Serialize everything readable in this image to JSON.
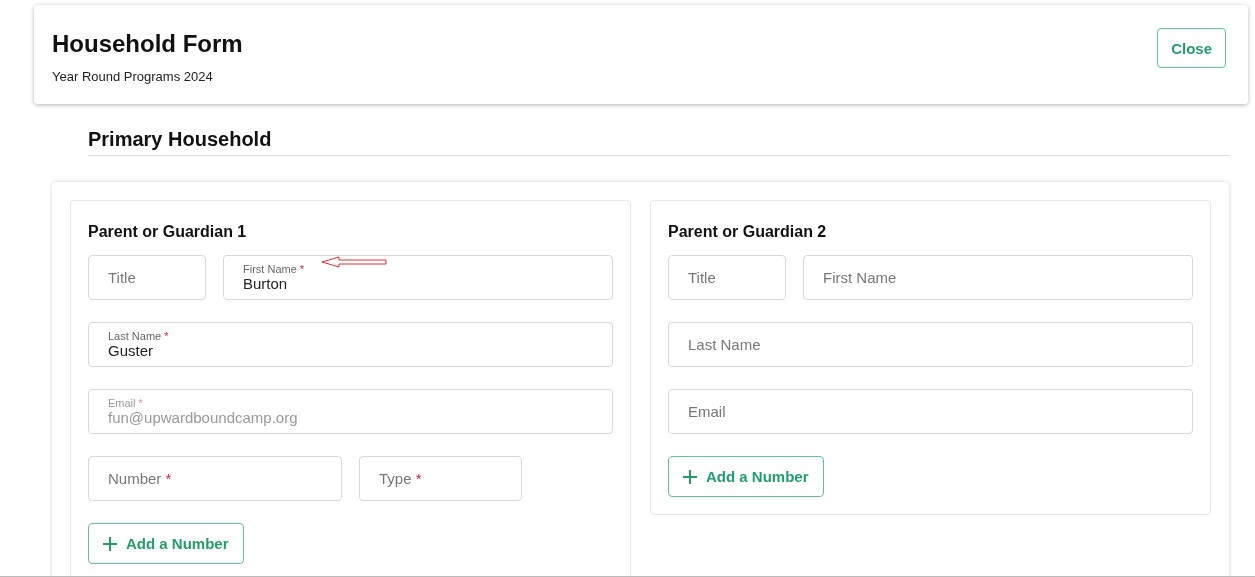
{
  "header": {
    "title": "Household Form",
    "subtitle": "Year Round Programs 2024",
    "close_button": "Close"
  },
  "section": {
    "title": "Primary Household"
  },
  "panels": [
    {
      "title": "Parent or Guardian 1",
      "rows": [
        [
          {
            "kind": "title",
            "placeholder": "Title",
            "disabled": false,
            "annotated": false
          },
          {
            "kind": "wide",
            "label": "First Name",
            "required_mark": "*",
            "value": "Burton",
            "disabled": false,
            "annotated": true
          }
        ],
        [
          {
            "kind": "wide",
            "label": "Last Name",
            "required_mark": "*",
            "value": "Guster",
            "disabled": false,
            "annotated": false
          }
        ],
        [
          {
            "kind": "wide",
            "label": "Email",
            "required_mark": "*",
            "value": "fun@upwardboundcamp.org",
            "disabled": true,
            "annotated": false
          }
        ],
        [
          {
            "kind": "number",
            "placeholder": "Number",
            "required_mark": "*",
            "disabled": false,
            "annotated": false
          },
          {
            "kind": "type",
            "placeholder": "Type",
            "required_mark": "*",
            "disabled": false,
            "annotated": false
          }
        ]
      ],
      "add_button": "Add a Number"
    },
    {
      "title": "Parent or Guardian 2",
      "rows": [
        [
          {
            "kind": "title",
            "placeholder": "Title",
            "disabled": false,
            "annotated": false
          },
          {
            "kind": "wide",
            "placeholder": "First Name",
            "disabled": false,
            "annotated": false
          }
        ],
        [
          {
            "kind": "wide",
            "placeholder": "Last Name",
            "disabled": false,
            "annotated": false
          }
        ],
        [
          {
            "kind": "wide",
            "placeholder": "Email",
            "disabled": false,
            "annotated": false
          }
        ]
      ],
      "add_button": "Add a Number"
    }
  ]
}
